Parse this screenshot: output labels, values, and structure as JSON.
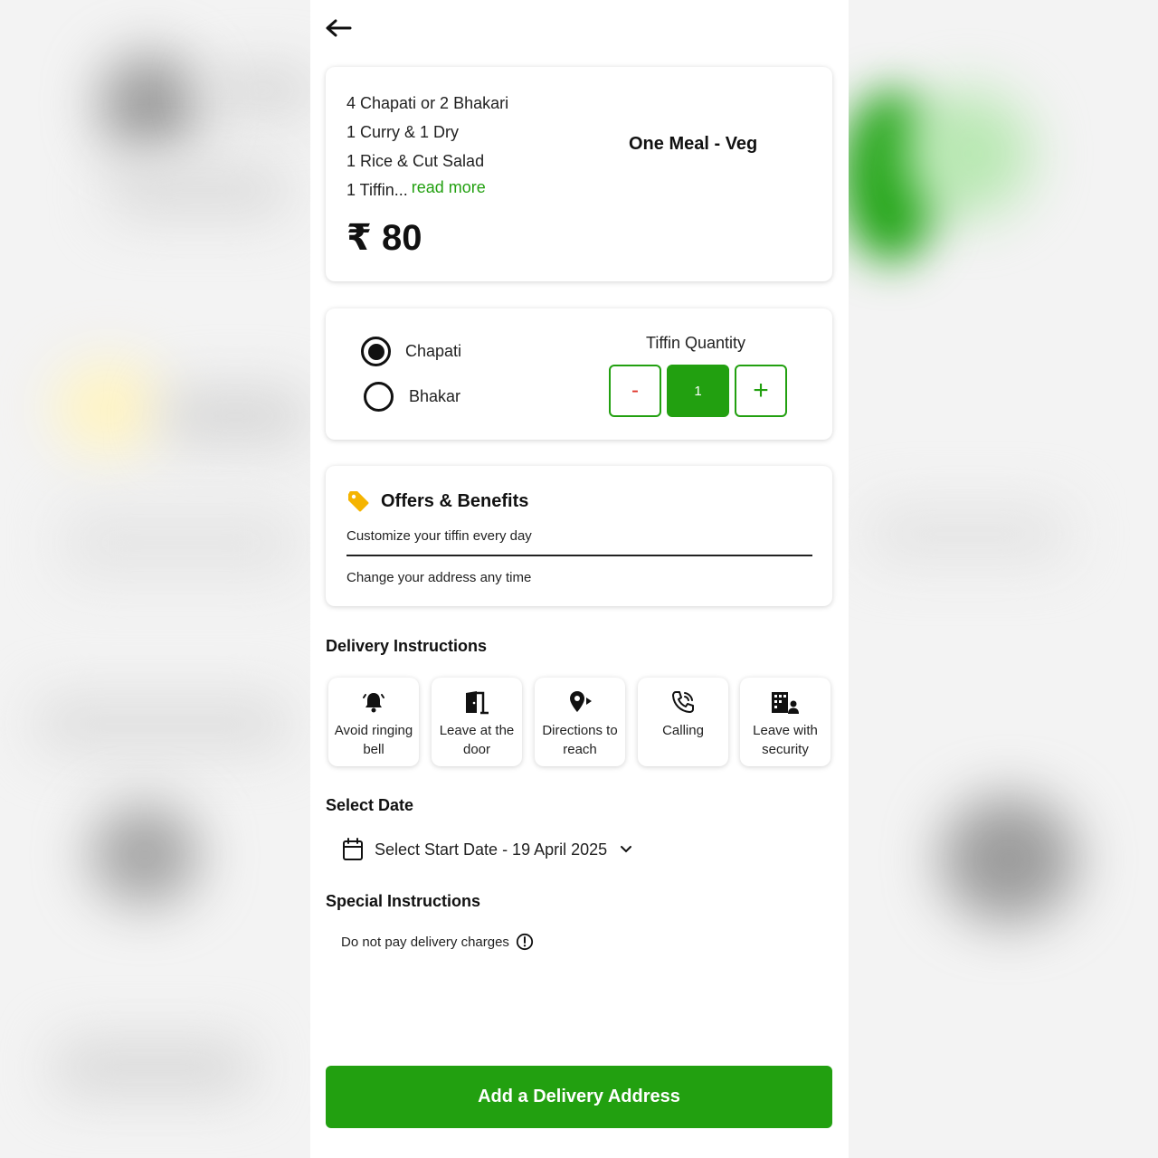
{
  "colors": {
    "accent": "#22a010",
    "minus": "#e0342a",
    "tag": "#f5b400"
  },
  "meal": {
    "items": [
      "4 Chapati or 2 Bhakari",
      "1 Curry & 1 Dry",
      "1 Rice & Cut Salad",
      "1 Tiffin..."
    ],
    "read_more": "read more",
    "title": "One Meal - Veg",
    "price": "₹ 80"
  },
  "options": {
    "radios": [
      {
        "label": "Chapati",
        "selected": true
      },
      {
        "label": "Bhakar",
        "selected": false
      }
    ],
    "quantity_title": "Tiffin Quantity",
    "minus_label": "-",
    "quantity": "1",
    "plus_label": "+"
  },
  "offers": {
    "title": "Offers & Benefits",
    "icon": "tag-icon",
    "lines": [
      "Customize your tiffin every day",
      "Change your address any time"
    ]
  },
  "delivery": {
    "title": "Delivery Instructions",
    "items": [
      {
        "label": "Avoid ringing bell",
        "icon": "bell-icon"
      },
      {
        "label": "Leave at the door",
        "icon": "door-icon"
      },
      {
        "label": "Directions to reach",
        "icon": "directions-icon"
      },
      {
        "label": "Calling",
        "icon": "phone-icon"
      },
      {
        "label": "Leave with security",
        "icon": "security-icon"
      }
    ]
  },
  "date": {
    "title": "Select Date",
    "label": "Select Start Date - 19 April 2025"
  },
  "special": {
    "title": "Special Instructions",
    "text": "Do not pay delivery charges"
  },
  "cta": {
    "label": "Add a Delivery Address"
  }
}
